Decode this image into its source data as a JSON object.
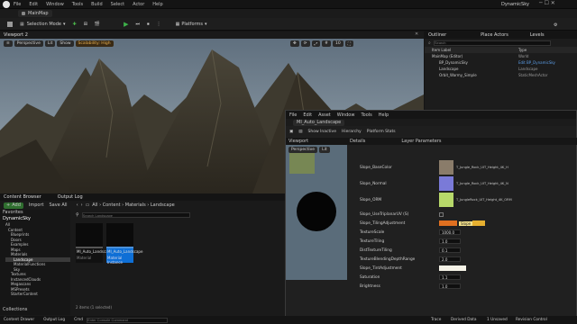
{
  "app": {
    "menu": [
      "File",
      "Edit",
      "Window",
      "Tools",
      "Build",
      "Select",
      "Actor",
      "Help"
    ],
    "map_tab": "MainMap",
    "project_name": "DynamicSky"
  },
  "toolbar": {
    "save_label": "",
    "mode_label": "Selection Mode",
    "platforms_label": "Platforms"
  },
  "viewport": {
    "tab": "Viewport 2",
    "perspective": "Perspective",
    "lit": "Lit",
    "show": "Show",
    "scalability": "Scalability: High",
    "fov": "10"
  },
  "outliner": {
    "tab": "Outliner",
    "place_actors": "Place Actors",
    "levels": "Levels",
    "search_placeholder": "Search",
    "col_item": "Item Label",
    "col_type": "Type",
    "rows": [
      {
        "label": "MainMap (Editor)",
        "type": "World"
      },
      {
        "label": "BP_DynamicSky",
        "type": "Edit BP_DynamicSky"
      },
      {
        "label": "Landscape",
        "type": "Landscape"
      },
      {
        "label": "Orbit_Warmy_Simple",
        "type": "StaticMeshActor"
      }
    ]
  },
  "content_browser": {
    "tab": "Content Browser",
    "output_log": "Output Log",
    "add": "Add",
    "import": "Import",
    "save_all": "Save All",
    "path": [
      "All",
      "Content",
      "Materials",
      "Landscape"
    ],
    "search_placeholder": "Search Landscape",
    "favorites": "Favorites",
    "root": "DynamicSky",
    "tree": [
      "All",
      "Content",
      "Blueprints",
      "Doors",
      "Examples",
      "Maps",
      "Materials",
      "Landscape",
      "MaterialFunctions",
      "Sky",
      "Textures",
      "InstancedClouds",
      "Megascans",
      "MSPresets",
      "StarterContent"
    ],
    "collections": "Collections",
    "assets": [
      {
        "name": "MI_Auto_Landscape",
        "sub": "Material"
      },
      {
        "name": "MI_Auto_Landscape",
        "sub": "Material Instance"
      }
    ],
    "status": "2 items (1 selected)",
    "drawer": "Content Drawer",
    "cmd": "Cmd",
    "console_placeholder": "Enter Console Command"
  },
  "material_editor": {
    "menu": [
      "File",
      "Edit",
      "Asset",
      "Window",
      "Tools",
      "Help"
    ],
    "tab": "MI_Auto_Landscape",
    "toolbar": [
      "Save",
      "Browse",
      "Show Inactive",
      "Hierarchy",
      "Platform Stats"
    ],
    "preview": {
      "tab": "Viewport",
      "perspective": "Perspective",
      "lit": "Lit"
    },
    "details_tab": "Details",
    "params_tab": "Layer Parameters",
    "rows": [
      {
        "name": "Slope_BaseColor",
        "value": "T_Jungle_Rock_UIT_Height_4K_H"
      },
      {
        "name": "Slope_Normal",
        "value": "T_Jungle_Rock_UIT_Height_4K_N"
      },
      {
        "name": "Slope_ORM",
        "value": "T_JungleRock_UIT_Height_4K_ORM"
      },
      {
        "name": "Slope_UseTriplanarUV (S)",
        "value": ""
      },
      {
        "name": "Slope_TilingAdjustment",
        "value": ""
      },
      {
        "name": "TextureScale",
        "value": "1000.0"
      },
      {
        "name": "TextureTiling",
        "value": "1.0"
      },
      {
        "name": "DistTextureTiling",
        "value": "0.1"
      },
      {
        "name": "TextureBlendingDepthRange",
        "value": "2.0"
      },
      {
        "name": "Slope_TintAdjustment",
        "value": ""
      },
      {
        "name": "Saturation",
        "value": "1.1"
      },
      {
        "name": "Brightness",
        "value": "1.0"
      }
    ],
    "tooltip": "Slope",
    "status_drawer": "Content Drawer",
    "status_log": "Output Log",
    "status_cmd": "Cmd",
    "unsaved": "1 Unsaved",
    "revision": "Revision"
  },
  "statusbar": {
    "drawer": "Content Drawer",
    "output_log": "Output Log",
    "cmd": "Cmd",
    "console_placeholder": "Enter Console Command",
    "trace": "Trace",
    "derived": "Derived Data",
    "unsaved": "1 Unsaved",
    "revision": "Revision Control"
  },
  "colors": {
    "accent": "#2d5c9a",
    "play": "#3db24a",
    "selected": "#0e6fd6"
  }
}
